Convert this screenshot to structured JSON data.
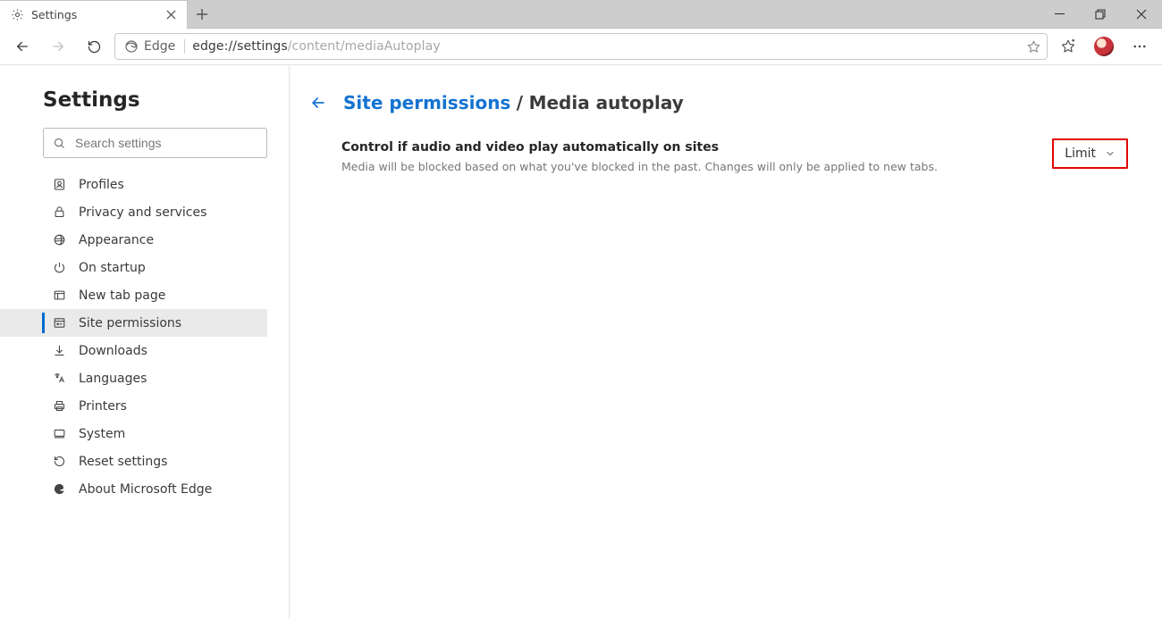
{
  "tab": {
    "title": "Settings"
  },
  "address": {
    "identity": "Edge",
    "url_dark": "edge://settings",
    "url_rest": "/content/mediaAutoplay"
  },
  "sidebar": {
    "title": "Settings",
    "search_placeholder": "Search settings",
    "items": [
      {
        "label": "Profiles"
      },
      {
        "label": "Privacy and services"
      },
      {
        "label": "Appearance"
      },
      {
        "label": "On startup"
      },
      {
        "label": "New tab page"
      },
      {
        "label": "Site permissions"
      },
      {
        "label": "Downloads"
      },
      {
        "label": "Languages"
      },
      {
        "label": "Printers"
      },
      {
        "label": "System"
      },
      {
        "label": "Reset settings"
      },
      {
        "label": "About Microsoft Edge"
      }
    ]
  },
  "breadcrumb": {
    "link": "Site permissions",
    "current": "Media autoplay"
  },
  "setting": {
    "title": "Control if audio and video play automatically on sites",
    "desc": "Media will be blocked based on what you've blocked in the past. Changes will only be applied to new tabs.",
    "options": {
      "selected": "Limit"
    }
  }
}
